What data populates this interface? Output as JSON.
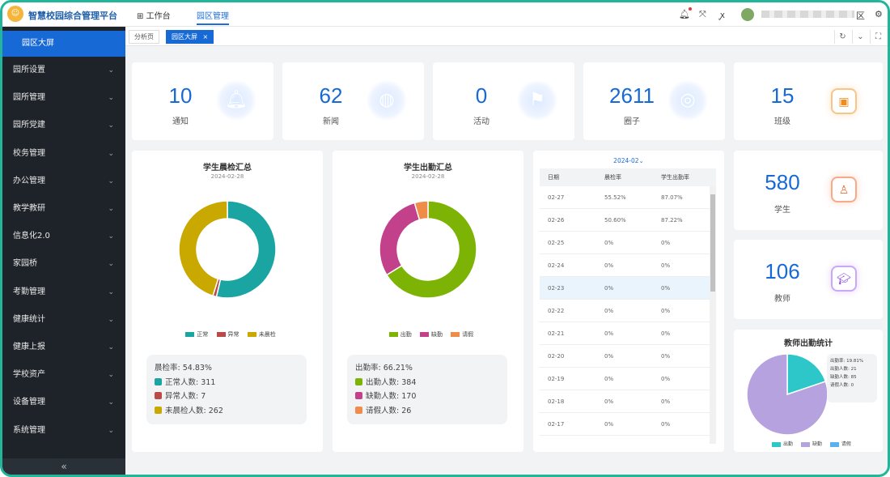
{
  "app": {
    "title": "智慧校园综合管理平台"
  },
  "topnav": [
    {
      "label": "工作台"
    },
    {
      "label": "园区管理"
    }
  ],
  "user": {
    "name_suffix": "区"
  },
  "sidebar": {
    "active": "园区大屏",
    "items": [
      {
        "label": "园所设置"
      },
      {
        "label": "园所管理"
      },
      {
        "label": "园所党建"
      },
      {
        "label": "校务管理"
      },
      {
        "label": "办公管理"
      },
      {
        "label": "教学教研"
      },
      {
        "label": "信息化2.0"
      },
      {
        "label": "家园桥"
      },
      {
        "label": "考勤管理"
      },
      {
        "label": "健康统计"
      },
      {
        "label": "健康上报"
      },
      {
        "label": "学校资产"
      },
      {
        "label": "设备管理"
      },
      {
        "label": "系统管理"
      }
    ],
    "collapse": "«"
  },
  "tabs": [
    {
      "label": "分析页"
    },
    {
      "label": "园区大屏",
      "close": "×"
    }
  ],
  "stats": [
    {
      "value": "10",
      "label": "通知",
      "icon": "bell-icon"
    },
    {
      "value": "62",
      "label": "新闻",
      "icon": "globe-news-icon"
    },
    {
      "value": "0",
      "label": "活动",
      "icon": "flag-icon"
    },
    {
      "value": "2611",
      "label": "圈子",
      "icon": "compass-icon"
    },
    {
      "value": "15",
      "label": "班级",
      "icon": "class-icon"
    },
    {
      "value": "580",
      "label": "学生",
      "icon": "student-icon"
    },
    {
      "value": "106",
      "label": "教师",
      "icon": "teacher-icon"
    }
  ],
  "morning": {
    "title": "学生晨检汇总",
    "date": "2024-02-28",
    "legend": [
      "正常",
      "异常",
      "未晨检"
    ],
    "rate_label": "晨检率:",
    "rate": "54.83%",
    "rows": [
      {
        "label": "正常人数:",
        "value": "311",
        "color": "#1aa5a2"
      },
      {
        "label": "异常人数:",
        "value": "7",
        "color": "#b94a48"
      },
      {
        "label": "未晨检人数:",
        "value": "262",
        "color": "#c9a800"
      }
    ]
  },
  "attendance": {
    "title": "学生出勤汇总",
    "date": "2024-02-28",
    "legend": [
      "出勤",
      "缺勤",
      "请假"
    ],
    "rate_label": "出勤率:",
    "rate": "66.21%",
    "rows": [
      {
        "label": "出勤人数:",
        "value": "384",
        "color": "#7cb305"
      },
      {
        "label": "缺勤人数:",
        "value": "170",
        "color": "#c2418a"
      },
      {
        "label": "请假人数:",
        "value": "26",
        "color": "#f08c4a"
      }
    ]
  },
  "table": {
    "month": "2024-02",
    "headers": [
      "日期",
      "晨检率",
      "学生出勤率"
    ],
    "rows": [
      [
        "02-27",
        "55.52%",
        "87.07%"
      ],
      [
        "02-26",
        "50.60%",
        "87.22%"
      ],
      [
        "02-25",
        "0%",
        "0%"
      ],
      [
        "02-24",
        "0%",
        "0%"
      ],
      [
        "02-23",
        "0%",
        "0%"
      ],
      [
        "02-22",
        "0%",
        "0%"
      ],
      [
        "02-21",
        "0%",
        "0%"
      ],
      [
        "02-20",
        "0%",
        "0%"
      ],
      [
        "02-19",
        "0%",
        "0%"
      ],
      [
        "02-18",
        "0%",
        "0%"
      ],
      [
        "02-17",
        "0%",
        "0%"
      ]
    ]
  },
  "teacher": {
    "title": "教师出勤统计",
    "legend": [
      "出勤",
      "缺勤",
      "请假"
    ],
    "summary": [
      "出勤率: 19.81%",
      "出勤人数: 21",
      "缺勤人数: 85",
      "请假人数: 0"
    ]
  },
  "chart_data": [
    {
      "type": "pie",
      "title": "学生晨检汇总",
      "labels": [
        "正常",
        "异常",
        "未晨检"
      ],
      "values": [
        311,
        7,
        262
      ],
      "colors": [
        "#1aa5a2",
        "#b94a48",
        "#c9a800"
      ],
      "donut": true
    },
    {
      "type": "pie",
      "title": "学生出勤汇总",
      "labels": [
        "出勤",
        "缺勤",
        "请假"
      ],
      "values": [
        384,
        170,
        26
      ],
      "colors": [
        "#7cb305",
        "#c2418a",
        "#f08c4a"
      ],
      "donut": true
    },
    {
      "type": "pie",
      "title": "教师出勤统计",
      "labels": [
        "出勤",
        "缺勤",
        "请假"
      ],
      "values": [
        21,
        85,
        0
      ],
      "colors": [
        "#2ec7c9",
        "#b6a2de",
        "#5ab1ef"
      ],
      "donut": false
    }
  ]
}
